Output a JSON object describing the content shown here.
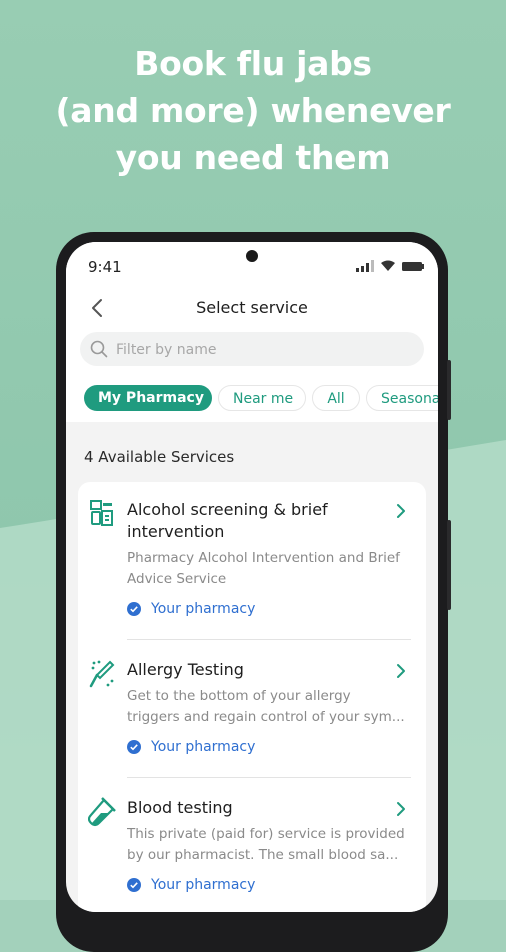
{
  "headline": {
    "line1": "Book flu jabs",
    "line2": "(and more) whenever",
    "line3": "you need them"
  },
  "status_bar": {
    "time": "9:41",
    "icons": [
      "signal-icon",
      "wifi-icon",
      "battery-icon"
    ]
  },
  "header": {
    "title": "Select service"
  },
  "search": {
    "placeholder": "Filter by name"
  },
  "filters": [
    {
      "label": "My Pharmacy",
      "active": true
    },
    {
      "label": "Near me",
      "active": false
    },
    {
      "label": "All",
      "active": false
    },
    {
      "label": "Seasonal",
      "active": false
    }
  ],
  "services_count_label": "4 Available Services",
  "services": [
    {
      "icon": "alcohol-screening-icon",
      "title": "Alcohol screening & brief intervention",
      "description": "Pharmacy Alcohol Intervention and Brief Advice Service",
      "badge": "Your pharmacy"
    },
    {
      "icon": "allergy-testing-icon",
      "title": "Allergy Testing",
      "description_line1": "Get to the bottom of your allergy",
      "description_line2": "triggers and regain control of your sym...",
      "badge": "Your pharmacy"
    },
    {
      "icon": "blood-test-icon",
      "title": "Blood testing",
      "description_line1": "This private (paid for) service is provided",
      "description_line2": "by our pharmacist. The small blood sa...",
      "badge": "Your pharmacy"
    }
  ],
  "colors": {
    "background": "#98cdb3",
    "accent": "#1f9b7f",
    "badge_blue": "#2f6fd0",
    "text_dark": "#1e1e1e",
    "text_muted": "#8a8a8a"
  }
}
